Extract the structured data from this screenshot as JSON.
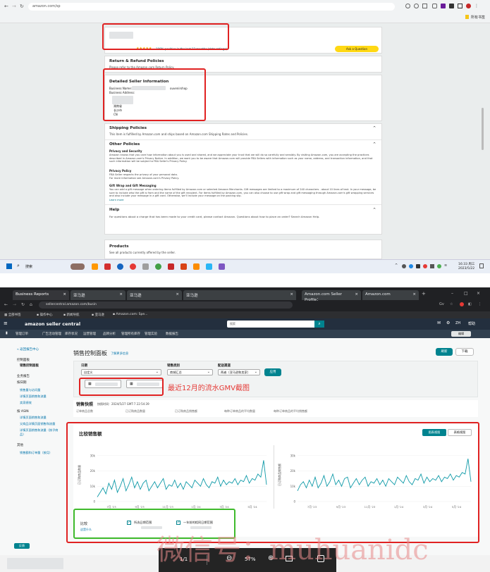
{
  "top": {
    "url": "amazon.com/sp",
    "bookmark": "所有书签",
    "seller_card": {
      "rating_text": "100% positive in the last 12 months (data ratings)",
      "cta": "Ask a Question"
    },
    "return_policies": {
      "title": "Return & Refund Policies",
      "body": "Please refer to the Amazon.com Return Policy."
    },
    "seller_info": {
      "title": "Detailed Seller Information",
      "business_name": "Business Name:",
      "business_address": "Business Address:",
      "suffix": "ouvenirshop",
      "addr1": "湖南省",
      "addr2": "长沙市",
      "country": "CN"
    },
    "shipping": {
      "title": "Shipping Policies",
      "body": "This item is fulfilled by Amazon.com and ships based on Amazon.com Shipping Rates and Policies."
    },
    "other": {
      "title": "Other Policies",
      "privacy_title": "Privacy and Security",
      "privacy_body": "Amazon knows that you care how information about you is used and shared, and we appreciate your trust that we will do so carefully and sensibly. By visiting Amazon.com, you are accepting the practices described in Amazon.com's Privacy Notice. In addition, we want you to be aware that Amazon.com will provide FBA Sellers with information such as your name, address, and transaction information, and that such information will be subject to FBA Seller's Privacy Policy.",
      "policy_title": "Privacy Policy",
      "policy_body": "FBA Seller respects the privacy of your personal data.",
      "policy_body2": "For more information see Amazon.com's Privacy Policy.",
      "gift_title": "Gift Wrap and Gift Messaging",
      "gift_body": "You can add a gift message when ordering items fulfilled by Amazon.com or selected Amazon Merchants. Gift messages are limited to a maximum of 240 characters - about 10 lines of text. In your message, be sure to include who the gift is from and the name of the gift recipient. For items fulfilled by Amazon.com, you can also choose to use gift wrap and gift messaging through Amazon.com's gift wrapping services and also include your message in a gift card. Otherwise, we'll include your message on the packing slip.",
      "learn_more": "Learn more"
    },
    "help": {
      "title": "Help",
      "body": "For questions about a charge that has been made to your credit card, please contact Amazon. Questions about how to place an order? Search Amazon Help."
    },
    "products": {
      "title": "Products",
      "body": "See all products currently offered by the seller."
    },
    "taskbar": {
      "search": "搜索",
      "time": "16:33 周三",
      "date": "2023/5/22"
    }
  },
  "bottom": {
    "tabs": [
      "Business Reports",
      "亚马逊",
      "亚马逊",
      "亚马逊",
      "Amazon.com Seller Profile：",
      "Amazon.com"
    ],
    "url": "sellercentral.amazon.com/busin",
    "bookmarks": [
      "全部书签",
      "操作中心",
      "新闻导航",
      "亚马逊",
      "Amazon.com: Spe..."
    ],
    "brand": "amazon seller central",
    "search_placeholder": "搜索",
    "lang": "ZH",
    "help": "帮助",
    "nav": [
      "管理订单",
      "广告活动管理",
      "库存状况",
      "运营管理",
      "品牌分析",
      "管理所有库存",
      "管理实验",
      "数据报告",
      "品牌",
      "目录"
    ],
    "edit": "编辑",
    "sidebar": {
      "back": "« 返回报告中心",
      "dashboards": "控制面板",
      "sales_dashboard": "销售控制面板",
      "business_reports": "业务报告",
      "by_date": "按日期",
      "date_items": [
        "销售量与访问量",
        "详情页面销售和流量",
        "卖家绩效"
      ],
      "by_asin": "按 ASIN",
      "asin_items": [
        "详情页面销售和流量",
        "父商品详情页面销售和流量",
        "详情页面销售和流量（按子商品）"
      ],
      "other": "其他",
      "other_items": [
        "销售额和订单量（按月）"
      ],
      "feedback": "反馈"
    },
    "title": "销售控制面板",
    "learn": "了解更多信息",
    "refresh": "刷新",
    "download": "下载",
    "filters": {
      "date_label": "日期",
      "date_value": "自定义",
      "category_label": "销售类别",
      "category_value": "商城汇总",
      "channel_label": "配送渠道",
      "channel_value": "两者（亚马逊和卖家）",
      "apply": "应用"
    },
    "annotation": "最近12月的流水GMV截图",
    "snapshot": {
      "title": "销售快照",
      "time": "快照时间：2024/5/27 GMT-7 22:54:39",
      "cols": [
        "订单商品总数",
        "已订购商品数量",
        "已订购商品销售额",
        "每种订单商品的平均数量",
        "每种订单商品的平均销售额"
      ]
    },
    "compare": {
      "title": "比较销售额",
      "graph_btn": "图表视图",
      "table_btn": "表格视图"
    },
    "chart_left": {
      "type": "line",
      "y_title": "已订购商品数量",
      "yticks": [
        "30k",
        "20k",
        "10k",
        "0"
      ],
      "xticks": [
        "7月 '23",
        "9月 '23",
        "11月 '23",
        "1月 '24",
        "3月 '24",
        "5月 '24"
      ],
      "ylim": [
        0,
        35000
      ]
    },
    "chart_right": {
      "type": "line",
      "y_title": "已订购商品销售额",
      "yticks": [
        "30k",
        "20k",
        "10k",
        "0"
      ],
      "xticks": [
        "7月 '23",
        "9月 '23",
        "11月 '23",
        "1月 '24",
        "3月 '24",
        "5月 '24"
      ],
      "ylim": [
        0,
        35000
      ]
    },
    "chart_data": [
      {
        "type": "line",
        "y_title": "已订购商品数量",
        "ylim": [
          0,
          35000
        ],
        "xticks": [
          "7月 '23",
          "9月 '23",
          "11月 '23",
          "1月 '24",
          "3月 '24",
          "5月 '24"
        ],
        "values": [
          3000,
          6000,
          9000,
          5000,
          12000,
          8000,
          14000,
          6000,
          10000,
          15000,
          7000,
          11000,
          16000,
          9000,
          13000,
          8000,
          12000,
          14000,
          7000,
          10000,
          13000,
          9000,
          12000,
          15000,
          8000,
          11000,
          10000,
          14000,
          9000,
          12000,
          8000,
          13000,
          11000,
          9000,
          14000,
          12000,
          10000,
          15000,
          11000,
          9000,
          13000,
          12000,
          16000,
          10000,
          14000,
          11000,
          13000,
          12000,
          15000,
          11000,
          14000,
          13000,
          17000,
          12000,
          15000,
          14000,
          18000,
          16000,
          27000,
          11000
        ]
      },
      {
        "type": "line",
        "y_title": "已订购商品销售额",
        "ylim": [
          0,
          35000
        ],
        "xticks": [
          "7月 '23",
          "9月 '23",
          "11月 '23",
          "1月 '24",
          "3月 '24",
          "5月 '24"
        ],
        "values": [
          7000,
          11000,
          13000,
          9000,
          14000,
          10000,
          16000,
          9000,
          12000,
          17000,
          10000,
          13000,
          18000,
          11000,
          14000,
          10000,
          15000,
          16000,
          9000,
          12000,
          15000,
          11000,
          14000,
          16000,
          10000,
          13000,
          12000,
          15000,
          11000,
          14000,
          10000,
          15000,
          13000,
          11000,
          16000,
          14000,
          12000,
          17000,
          13000,
          11000,
          15000,
          14000,
          18000,
          12000,
          16000,
          13000,
          15000,
          14000,
          17000,
          13000,
          16000,
          15000,
          18000,
          14000,
          17000,
          16000,
          19000,
          18000,
          28000,
          13000
        ]
      }
    ],
    "legend": {
      "compare": "比较",
      "what": "这是什么",
      "item1": "所选日期范围",
      "item2": "一年前的相同日期范围"
    },
    "pdf": {
      "pages": "1/1",
      "zoom": "57%"
    },
    "watermark": "微信号：muhuanidc"
  }
}
